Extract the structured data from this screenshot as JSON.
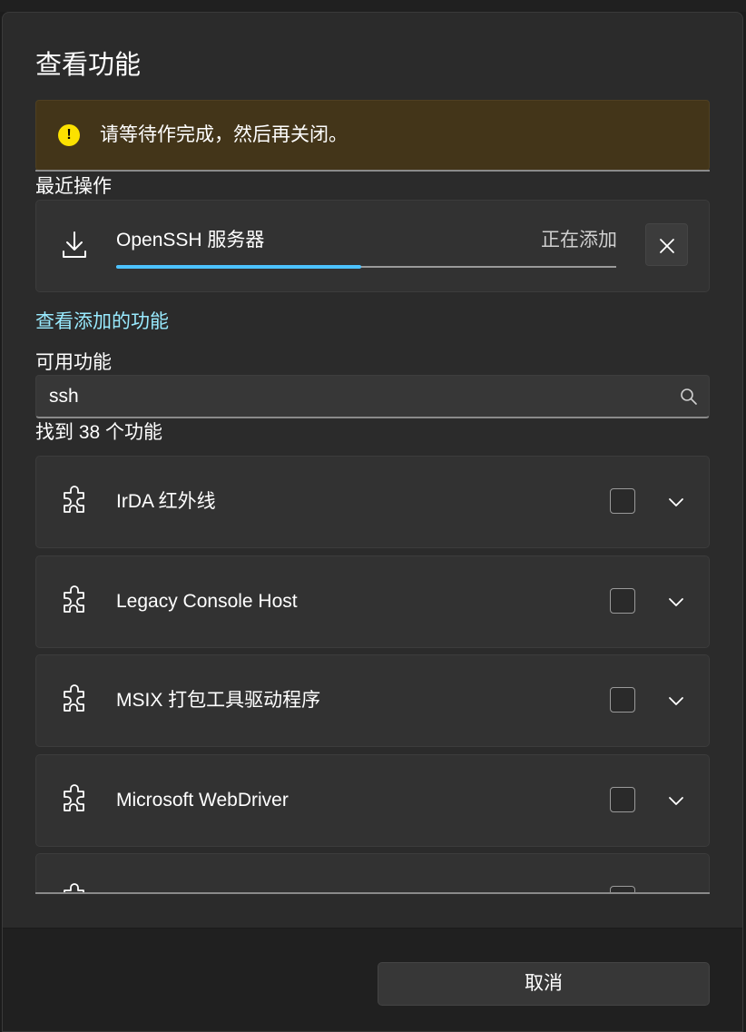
{
  "dialog": {
    "title": "查看功能"
  },
  "warning": {
    "icon": "warning-icon",
    "text": "请等待作完成，然后再关闭。",
    "color": "#fce100"
  },
  "recent": {
    "heading": "最近操作",
    "item": {
      "icon": "download-icon",
      "name": "OpenSSH 服务器",
      "status": "正在添加",
      "progress": 0.49,
      "cancel_icon": "close-icon"
    }
  },
  "link": {
    "text": "查看添加的功能"
  },
  "available": {
    "heading": "可用功能",
    "search": {
      "value": "ssh",
      "icon": "search-icon"
    },
    "found_text": "找到 38 个功能",
    "features": [
      {
        "label": "IrDA 红外线",
        "checked": false
      },
      {
        "label": "Legacy Console Host",
        "checked": false
      },
      {
        "label": "MSIX 打包工具驱动程序",
        "checked": false
      },
      {
        "label": "Microsoft WebDriver",
        "checked": false
      },
      {
        "label": "",
        "checked": false
      }
    ]
  },
  "footer": {
    "cancel_label": "取消"
  },
  "colors": {
    "accent": "#4cc2ff",
    "link": "#99ebff",
    "warning_bg": "#433519"
  }
}
